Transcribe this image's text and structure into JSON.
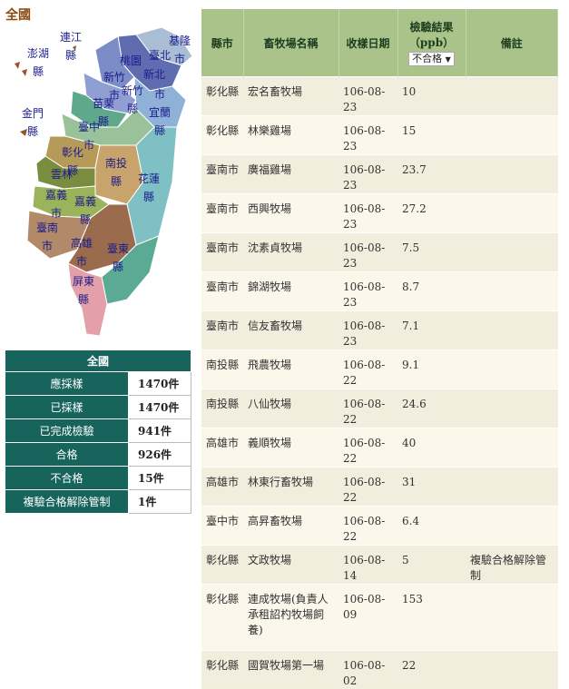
{
  "map": {
    "title": "全國",
    "regions": [
      {
        "id": "penghu",
        "chars": [
          "澎湖",
          "縣"
        ]
      },
      {
        "id": "lienchiang",
        "chars": [
          "連江",
          "縣"
        ]
      },
      {
        "id": "kinmen",
        "chars": [
          "金門",
          "縣"
        ]
      },
      {
        "id": "keelung",
        "chars": [
          "基隆",
          "市"
        ]
      },
      {
        "id": "taipei",
        "chars": [
          "臺北"
        ]
      },
      {
        "id": "taoyuan",
        "chars": [
          "桃園"
        ]
      },
      {
        "id": "newtaipei",
        "chars": [
          "新北"
        ]
      },
      {
        "id": "hsinchu-city",
        "chars": [
          "新竹",
          "市"
        ]
      },
      {
        "id": "hsinchu-county",
        "chars": [
          "新竹",
          "縣"
        ]
      },
      {
        "id": "yilan",
        "chars": [
          "市",
          "宜蘭",
          "縣"
        ]
      },
      {
        "id": "miaoli",
        "chars": [
          "苗栗",
          "縣"
        ]
      },
      {
        "id": "taichung",
        "chars": [
          "臺中",
          "市"
        ]
      },
      {
        "id": "changhua",
        "chars": [
          "彰化",
          "縣"
        ]
      },
      {
        "id": "nantou",
        "chars": [
          "南投",
          "縣"
        ]
      },
      {
        "id": "hualien",
        "chars": [
          "花蓮",
          "縣"
        ]
      },
      {
        "id": "yunlin",
        "chars": [
          "雲林"
        ]
      },
      {
        "id": "chiayi-county",
        "chars": [
          "嘉義",
          "縣"
        ]
      },
      {
        "id": "chiayi-city",
        "chars": [
          "嘉義",
          "市"
        ]
      },
      {
        "id": "tainan",
        "chars": [
          "臺南",
          "市"
        ]
      },
      {
        "id": "kaohsiung",
        "chars": [
          "高雄",
          "市"
        ]
      },
      {
        "id": "taitung",
        "chars": [
          "臺東",
          "縣"
        ]
      },
      {
        "id": "pingtung",
        "chars": [
          "屏東",
          "縣"
        ]
      }
    ]
  },
  "stats": {
    "header": "全國",
    "rows": [
      {
        "label": "應採樣",
        "value": "1470件"
      },
      {
        "label": "已採樣",
        "value": "1470件"
      },
      {
        "label": "已完成檢驗",
        "value": "941件"
      },
      {
        "label": "合格",
        "value": "926件"
      },
      {
        "label": "不合格",
        "value": "15件"
      },
      {
        "label": "複驗合格解除管制",
        "value": "1件"
      }
    ]
  },
  "table": {
    "headers": {
      "county": "縣市",
      "farm": "畜牧場名稱",
      "date": "收樣日期",
      "result_line1": "檢驗結果",
      "result_line2": "（ppb）",
      "note": "備註"
    },
    "filter": {
      "selected": "不合格",
      "arrow": "▼"
    },
    "rows": [
      {
        "county": "彰化縣",
        "farm": "宏名畜牧場",
        "date": "106-08-23",
        "result": "10",
        "note": ""
      },
      {
        "county": "彰化縣",
        "farm": "林樂雞場",
        "date": "106-08-23",
        "result": "15",
        "note": ""
      },
      {
        "county": "臺南市",
        "farm": "廣福雞場",
        "date": "106-08-23",
        "result": "23.7",
        "note": ""
      },
      {
        "county": "臺南市",
        "farm": "西興牧場",
        "date": "106-08-23",
        "result": "27.2",
        "note": ""
      },
      {
        "county": "臺南市",
        "farm": "沈素貞牧場",
        "date": "106-08-23",
        "result": "7.5",
        "note": ""
      },
      {
        "county": "臺南市",
        "farm": "錦湖牧場",
        "date": "106-08-23",
        "result": "8.7",
        "note": ""
      },
      {
        "county": "臺南市",
        "farm": "信友畜牧場",
        "date": "106-08-23",
        "result": "7.1",
        "note": ""
      },
      {
        "county": "南投縣",
        "farm": "飛農牧場",
        "date": "106-08-22",
        "result": "9.1",
        "note": ""
      },
      {
        "county": "南投縣",
        "farm": "八仙牧場",
        "date": "106-08-22",
        "result": "24.6",
        "note": ""
      },
      {
        "county": "高雄市",
        "farm": "義順牧場",
        "date": "106-08-22",
        "result": "40",
        "note": ""
      },
      {
        "county": "高雄市",
        "farm": "林東行畜牧場",
        "date": "106-08-22",
        "result": "31",
        "note": ""
      },
      {
        "county": "臺中市",
        "farm": "高昇畜牧場",
        "date": "106-08-22",
        "result": "6.4",
        "note": ""
      },
      {
        "county": "彰化縣",
        "farm": "文政牧場",
        "date": "106-08-14",
        "result": "5",
        "note": "複驗合格解除管制"
      },
      {
        "county": "彰化縣",
        "farm": "連成牧場(負責人承租詔杓牧場飼養)",
        "date": "106-08-09",
        "result": "153",
        "note": ""
      },
      {
        "county": "彰化縣",
        "farm": "國賀牧場第一場",
        "date": "106-08-02",
        "result": "22",
        "note": ""
      }
    ]
  }
}
